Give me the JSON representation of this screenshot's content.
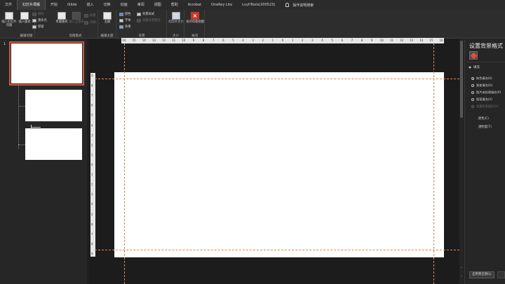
{
  "menu": {
    "tabs": [
      "文件",
      "幻灯片母版",
      "开始",
      "iSlide",
      "插入",
      "切换",
      "动画",
      "审阅",
      "视图",
      "帮助",
      "Acrobat",
      "OneKey Lite",
      "LvyhTools(200523)"
    ],
    "active": "幻灯片母版",
    "tell_me": "操作说明搜索"
  },
  "ribbon": {
    "edit_master": {
      "insert_master": "插入幻灯片母版",
      "insert_layout": "插入版式",
      "delete": "删除",
      "rename": "重命名",
      "preserve": "保留",
      "group_label": "编辑母版"
    },
    "master_layout": {
      "master_layout": "母版版式",
      "insert_placeholder": "插入占位符",
      "title": "标题",
      "footer": "页脚",
      "group_label": "母版版式"
    },
    "edit_theme": {
      "themes": "主题",
      "group_label": "编辑主题"
    },
    "background": {
      "colors": "颜色",
      "fonts": "字体",
      "effects": "效果",
      "bg_styles": "背景样式",
      "hide_bg": "隐藏背景图形",
      "group_label": "背景"
    },
    "size": {
      "slide_size": "幻灯片大小",
      "group_label": "大小"
    },
    "close": {
      "close_view": "关闭母版视图",
      "group_label": "关闭"
    }
  },
  "thumbnails": {
    "slide_number": "1"
  },
  "ruler": {
    "h_ticks": [
      "16",
      "15",
      "14",
      "13",
      "12",
      "11",
      "10",
      "9",
      "8",
      "7",
      "6",
      "5",
      "4",
      "3",
      "2",
      "1",
      "0",
      "1",
      "2",
      "3",
      "4",
      "5",
      "6",
      "7",
      "8",
      "9",
      "10",
      "11",
      "12",
      "13",
      "14",
      "15",
      "16"
    ],
    "v_ticks": [
      "9",
      "8",
      "7",
      "6",
      "5",
      "4",
      "3",
      "2",
      "1",
      "0",
      "1",
      "2",
      "3",
      "4",
      "5",
      "6",
      "7",
      "8",
      "9"
    ]
  },
  "format_pane": {
    "title": "设置背景格式",
    "fill_section": "填充",
    "fill_options": [
      "纯色填充(S)",
      "渐变填充(G)",
      "图片或纹理填充(P)",
      "图案填充(A)",
      "隐藏背景图形(H)"
    ],
    "color_label": "颜色(C)",
    "transparency_label": "透明度(T)",
    "apply_all": "应用到全部(L)"
  },
  "colors": {
    "accent": "#c55a3f",
    "close_red": "#c0392b",
    "guide": "#d98a57"
  }
}
